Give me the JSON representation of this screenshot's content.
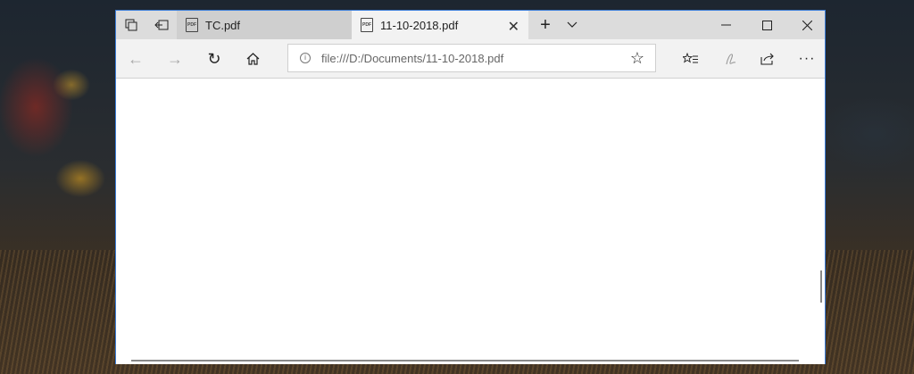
{
  "tabs": [
    {
      "title": "TC.pdf",
      "icon": "pdf-icon",
      "active": false
    },
    {
      "title": "11-10-2018.pdf",
      "icon": "pdf-icon",
      "active": true
    }
  ],
  "address": {
    "url": "file:///D:/Documents/11-10-2018.pdf"
  },
  "pdf_icon_text": "PDF",
  "icons": {
    "new_tab": "+",
    "tab_list": "⌄",
    "minimize": "—",
    "maximize": "☐",
    "close": "✕",
    "tab_close": "✕",
    "back": "←",
    "forward": "→",
    "refresh": "↻",
    "home": "⌂",
    "info": "i",
    "favorite": "☆",
    "more": "···"
  },
  "colors": {
    "window_border": "#3b7dd8",
    "tabbar": "#dcdcdc",
    "active_tab": "#f2f2f2"
  }
}
